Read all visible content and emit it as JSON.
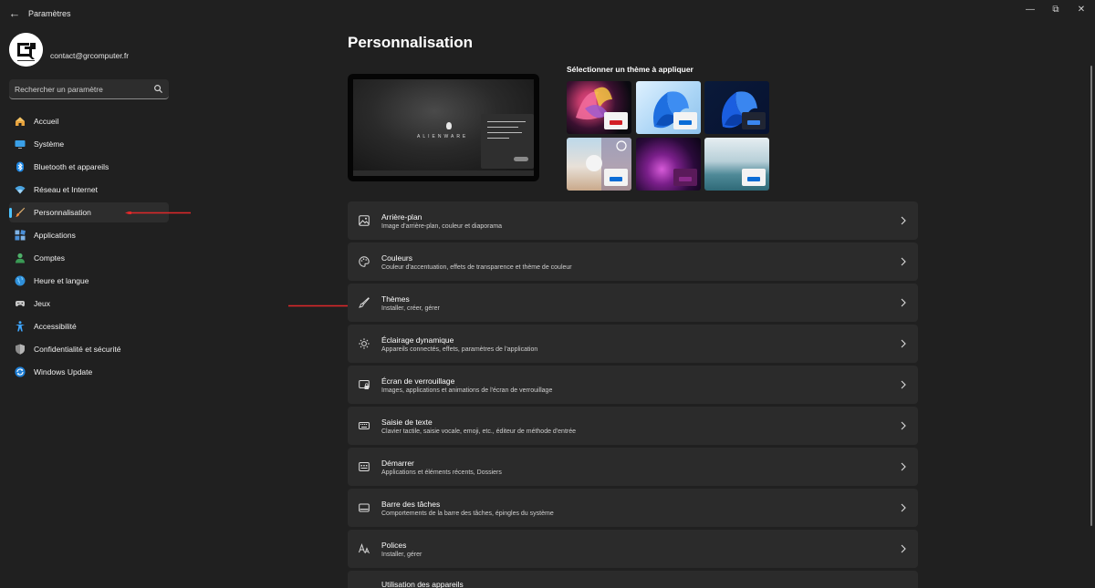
{
  "window": {
    "title": "Paramètres",
    "controls": [
      "minimize-icon",
      "restore-icon",
      "close-icon"
    ]
  },
  "account": {
    "email": "contact@grcomputer.fr",
    "avatar_icon": "gr-computer-logo"
  },
  "search": {
    "placeholder": "Rechercher un paramètre"
  },
  "sidebar": {
    "items": [
      {
        "label": "Accueil",
        "icon": "home-icon"
      },
      {
        "label": "Système",
        "icon": "monitor-icon"
      },
      {
        "label": "Bluetooth et appareils",
        "icon": "bluetooth-icon"
      },
      {
        "label": "Réseau et Internet",
        "icon": "wifi-icon"
      },
      {
        "label": "Personnalisation",
        "icon": "paintbrush-icon",
        "selected": true
      },
      {
        "label": "Applications",
        "icon": "apps-icon"
      },
      {
        "label": "Comptes",
        "icon": "person-icon"
      },
      {
        "label": "Heure et langue",
        "icon": "globe-icon"
      },
      {
        "label": "Jeux",
        "icon": "gamepad-icon"
      },
      {
        "label": "Accessibilité",
        "icon": "accessibility-icon"
      },
      {
        "label": "Confidentialité et sécurité",
        "icon": "shield-icon"
      },
      {
        "label": "Windows Update",
        "icon": "update-icon"
      }
    ]
  },
  "main": {
    "title": "Personnalisation",
    "preview_brand": "ALIENWARE",
    "themes_title": "Sélectionner un thème à appliquer",
    "settings": [
      {
        "title": "Arrière-plan",
        "subtitle": "Image d'arrière-plan, couleur et diaporama",
        "icon": "image-icon"
      },
      {
        "title": "Couleurs",
        "subtitle": "Couleur d'accentuation, effets de transparence et thème de couleur",
        "icon": "palette-icon"
      },
      {
        "title": "Thèmes",
        "subtitle": "Installer, créer, gérer",
        "icon": "brush-icon"
      },
      {
        "title": "Éclairage dynamique",
        "subtitle": "Appareils connectés, effets, paramètres de l'application",
        "icon": "sun-icon"
      },
      {
        "title": "Écran de verrouillage",
        "subtitle": "Images, applications et animations de l'écran de verrouillage",
        "icon": "lockscreen-icon"
      },
      {
        "title": "Saisie de texte",
        "subtitle": "Clavier tactile, saisie vocale, emoji, etc., éditeur de méthode d'entrée",
        "icon": "keyboard-icon"
      },
      {
        "title": "Démarrer",
        "subtitle": "Applications et éléments récents, Dossiers",
        "icon": "start-icon"
      },
      {
        "title": "Barre des tâches",
        "subtitle": "Comportements de la barre des tâches, épingles du système",
        "icon": "taskbar-icon"
      },
      {
        "title": "Polices",
        "subtitle": "Installer, gérer",
        "icon": "fonts-icon"
      },
      {
        "title": "Utilisation des appareils",
        "subtitle": "",
        "icon": "devices-icon"
      }
    ]
  },
  "colors": {
    "accent": "#4cc2ff",
    "background": "#202020",
    "card": "#2b2b2b",
    "annotation_arrow": "#e0282a"
  }
}
